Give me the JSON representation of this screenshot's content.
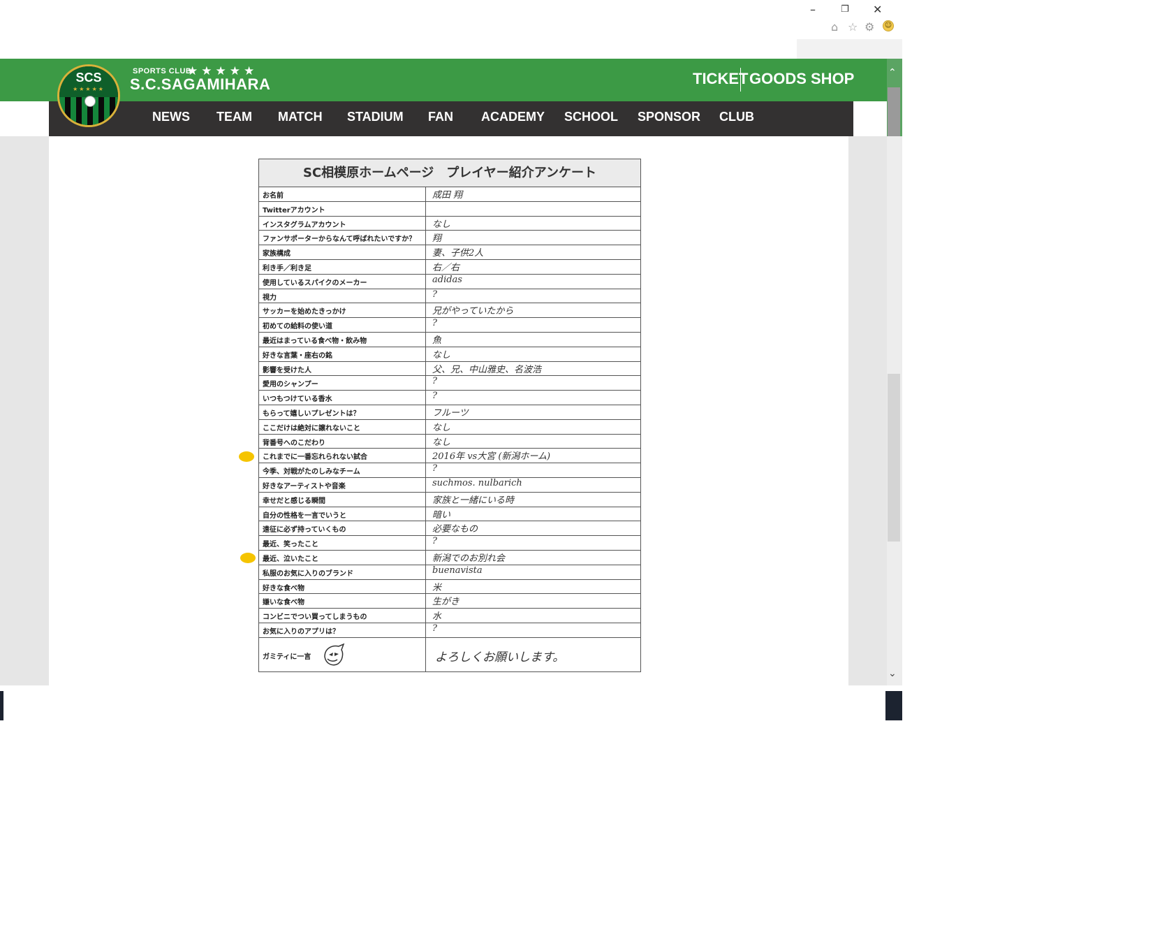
{
  "window": {
    "minimize": "–",
    "restore": "❐",
    "close": "✕",
    "toolbar_icons": {
      "home": "⌂",
      "favorites": "☆",
      "settings": "⚙",
      "smiley": "☺"
    }
  },
  "site": {
    "logo_text": "SCS",
    "brand_small": "SPORTS CLUB",
    "brand_stars": "★★★★★",
    "brand_big": "S.C.SAGAMIHARA",
    "header_links": [
      "TICKET",
      "GOODS SHOP"
    ],
    "nav": [
      "NEWS",
      "TEAM",
      "MATCH",
      "STADIUM",
      "FAN",
      "ACADEMY",
      "SCHOOL",
      "SPONSOR",
      "CLUB"
    ],
    "colors": {
      "green": "#3c9a45",
      "dark": "#333131",
      "gold": "#d9b23a"
    }
  },
  "survey": {
    "title": "SC相模原ホームページ　プレイヤー紹介アンケート",
    "rows": [
      {
        "q": "お名前",
        "a": "成田 翔"
      },
      {
        "q": "Twitterアカウント",
        "a": ""
      },
      {
        "q": "インスタグラムアカウント",
        "a": "なし"
      },
      {
        "q": "ファンサポーターからなんて呼ばれたいですか？",
        "a": "翔"
      },
      {
        "q": "家族構成",
        "a": "妻、子供2人"
      },
      {
        "q": "利き手／利き足",
        "a": "右／右"
      },
      {
        "q": "使用しているスパイクのメーカー",
        "a": "adidas"
      },
      {
        "q": "視力",
        "a": "?"
      },
      {
        "q": "サッカーを始めたきっかけ",
        "a": "兄がやっていたから"
      },
      {
        "q": "初めての給料の使い道",
        "a": "?"
      },
      {
        "q": "最近はまっている食べ物・飲み物",
        "a": "魚"
      },
      {
        "q": "好きな言葉・座右の銘",
        "a": "なし"
      },
      {
        "q": "影響を受けた人",
        "a": "父、兄、中山雅史、名波浩"
      },
      {
        "q": "愛用のシャンプー",
        "a": "?"
      },
      {
        "q": "いつもつけている香水",
        "a": "?"
      },
      {
        "q": "もらって嬉しいプレゼントは？",
        "a": "フルーツ"
      },
      {
        "q": "ここだけは絶対に譲れないこと",
        "a": "なし"
      },
      {
        "q": "背番号へのこだわり",
        "a": "なし"
      },
      {
        "q": "これまでに一番忘れられない試合",
        "a": "2016年 vs大宮 (新潟ホーム)"
      },
      {
        "q": "今季、対戦がたのしみなチーム",
        "a": "?"
      },
      {
        "q": "好きなアーティストや音楽",
        "a": "suchmos. nulbarich"
      },
      {
        "q": "幸せだと感じる瞬間",
        "a": "家族と一緒にいる時"
      },
      {
        "q": "自分の性格を一言でいうと",
        "a": "暗い"
      },
      {
        "q": "遠征に必ず持っていくもの",
        "a": "必要なもの"
      },
      {
        "q": "最近、笑ったこと",
        "a": "?"
      },
      {
        "q": "最近、泣いたこと",
        "a": "新潟でのお別れ会"
      },
      {
        "q": "私服のお気に入りのブランド",
        "a": "buenavista"
      },
      {
        "q": "好きな食べ物",
        "a": "米"
      },
      {
        "q": "嫌いな食べ物",
        "a": "生がき"
      },
      {
        "q": "コンビニでつい買ってしまうもの",
        "a": "水"
      },
      {
        "q": "お気に入りのアプリは？",
        "a": "?"
      }
    ],
    "final_q": "ガミティに一言",
    "final_a": "よろしくお願いします。"
  },
  "scroll": {
    "up": "⌃",
    "down": "⌄"
  }
}
